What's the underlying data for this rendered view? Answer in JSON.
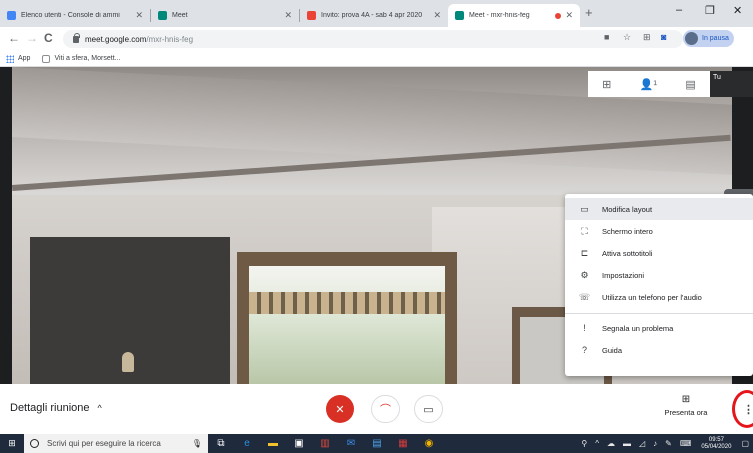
{
  "browser": {
    "tabs": [
      {
        "title": "Elenco utenti - Console di ammi",
        "favicon_color": "#4285f4",
        "active": false
      },
      {
        "title": "Meet",
        "favicon_color": "#00897b",
        "active": false
      },
      {
        "title": "Invito: prova 4A - sab 4 apr 2020",
        "favicon_color": "#ea4335",
        "active": false
      },
      {
        "title": "Meet - mxr-hnis-feg",
        "favicon_color": "#00897b",
        "active": true,
        "recording": true
      }
    ],
    "new_tab": "+",
    "window_controls": {
      "minimize": "–",
      "maximize": "❐",
      "close": "✕"
    },
    "nav": {
      "back": "←",
      "forward": "→",
      "reload": "C"
    },
    "url_host": "meet.google.com",
    "url_path": "/mxr-hnis-feg",
    "profile_label": "In pausa",
    "bookmarks": [
      {
        "label": "App",
        "icon": "apps-grid-icon"
      },
      {
        "label": "Viti a sfera, Morsett...",
        "icon": "bookmark-favicon"
      }
    ]
  },
  "meet": {
    "self_label": "Tu",
    "top_controls": [
      "⊞",
      "👤¹",
      "▤"
    ],
    "menu_toggle_icon": "pen-icon",
    "menu": [
      {
        "label": "Modifica layout",
        "icon": "▭",
        "highlighted": true
      },
      {
        "label": "Schermo intero",
        "icon": "⛶"
      },
      {
        "label": "Attiva sottotitoli",
        "icon": "⊏"
      },
      {
        "label": "Impostazioni",
        "icon": "⚙"
      },
      {
        "label": "Utilizza un telefono per l'audio",
        "icon": "☏"
      },
      {
        "label": "Segnala un problema",
        "icon": "!"
      },
      {
        "label": "Guida",
        "icon": "?"
      }
    ],
    "bottom": {
      "details_label": "Dettagli riunione",
      "details_chevron": "^",
      "mic_icon": "✕",
      "hangup_icon": "⌒",
      "camera_icon": "▭",
      "present_label": "Presenta ora",
      "present_icon": "⊞",
      "more_icon": "⋮"
    }
  },
  "taskbar": {
    "start_icon": "⊞",
    "search_placeholder": "Scrivi qui per eseguire la ricerca",
    "clock_time": "09:57",
    "clock_date": "05/04/2020"
  },
  "colors": {
    "hangup_red": "#d93025",
    "menu_bg": "#ffffff",
    "taskbar_bg": "#1f2b3c",
    "highlight_circle": "#e4161b"
  }
}
